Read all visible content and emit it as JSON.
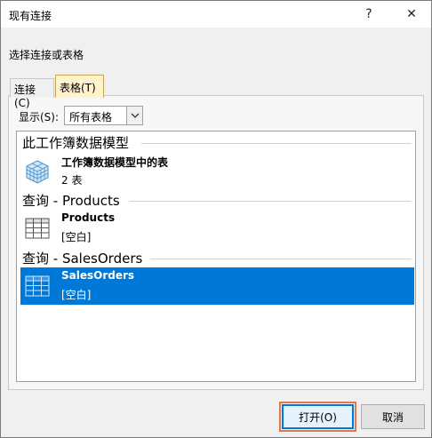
{
  "window": {
    "title": "现有连接",
    "help": "?",
    "close": "✕"
  },
  "subtitle": "选择连接或表格",
  "tabs": [
    {
      "label": "连接(C)"
    },
    {
      "label": "表格(T)"
    }
  ],
  "filter": {
    "label": "显示(S):",
    "value": "所有表格"
  },
  "groups": [
    {
      "header": "此工作簿数据模型",
      "items": [
        {
          "name": "工作簿数据模型中的表",
          "sub": "2 表",
          "icon": "data-model-cube-icon"
        }
      ]
    },
    {
      "header": "查询 - Products",
      "items": [
        {
          "name": "Products",
          "sub": "[空白]",
          "icon": "table-grid-icon"
        }
      ]
    },
    {
      "header": "查询 - SalesOrders",
      "items": [
        {
          "name": "SalesOrders",
          "sub": "[空白]",
          "icon": "table-grid-icon",
          "selected": true
        }
      ]
    }
  ],
  "buttons": {
    "open": "打开(O)",
    "cancel": "取消"
  },
  "colors": {
    "selection": "#0078d7",
    "active_tab": "#fff2cc",
    "highlight_outline": "#e0774d"
  }
}
